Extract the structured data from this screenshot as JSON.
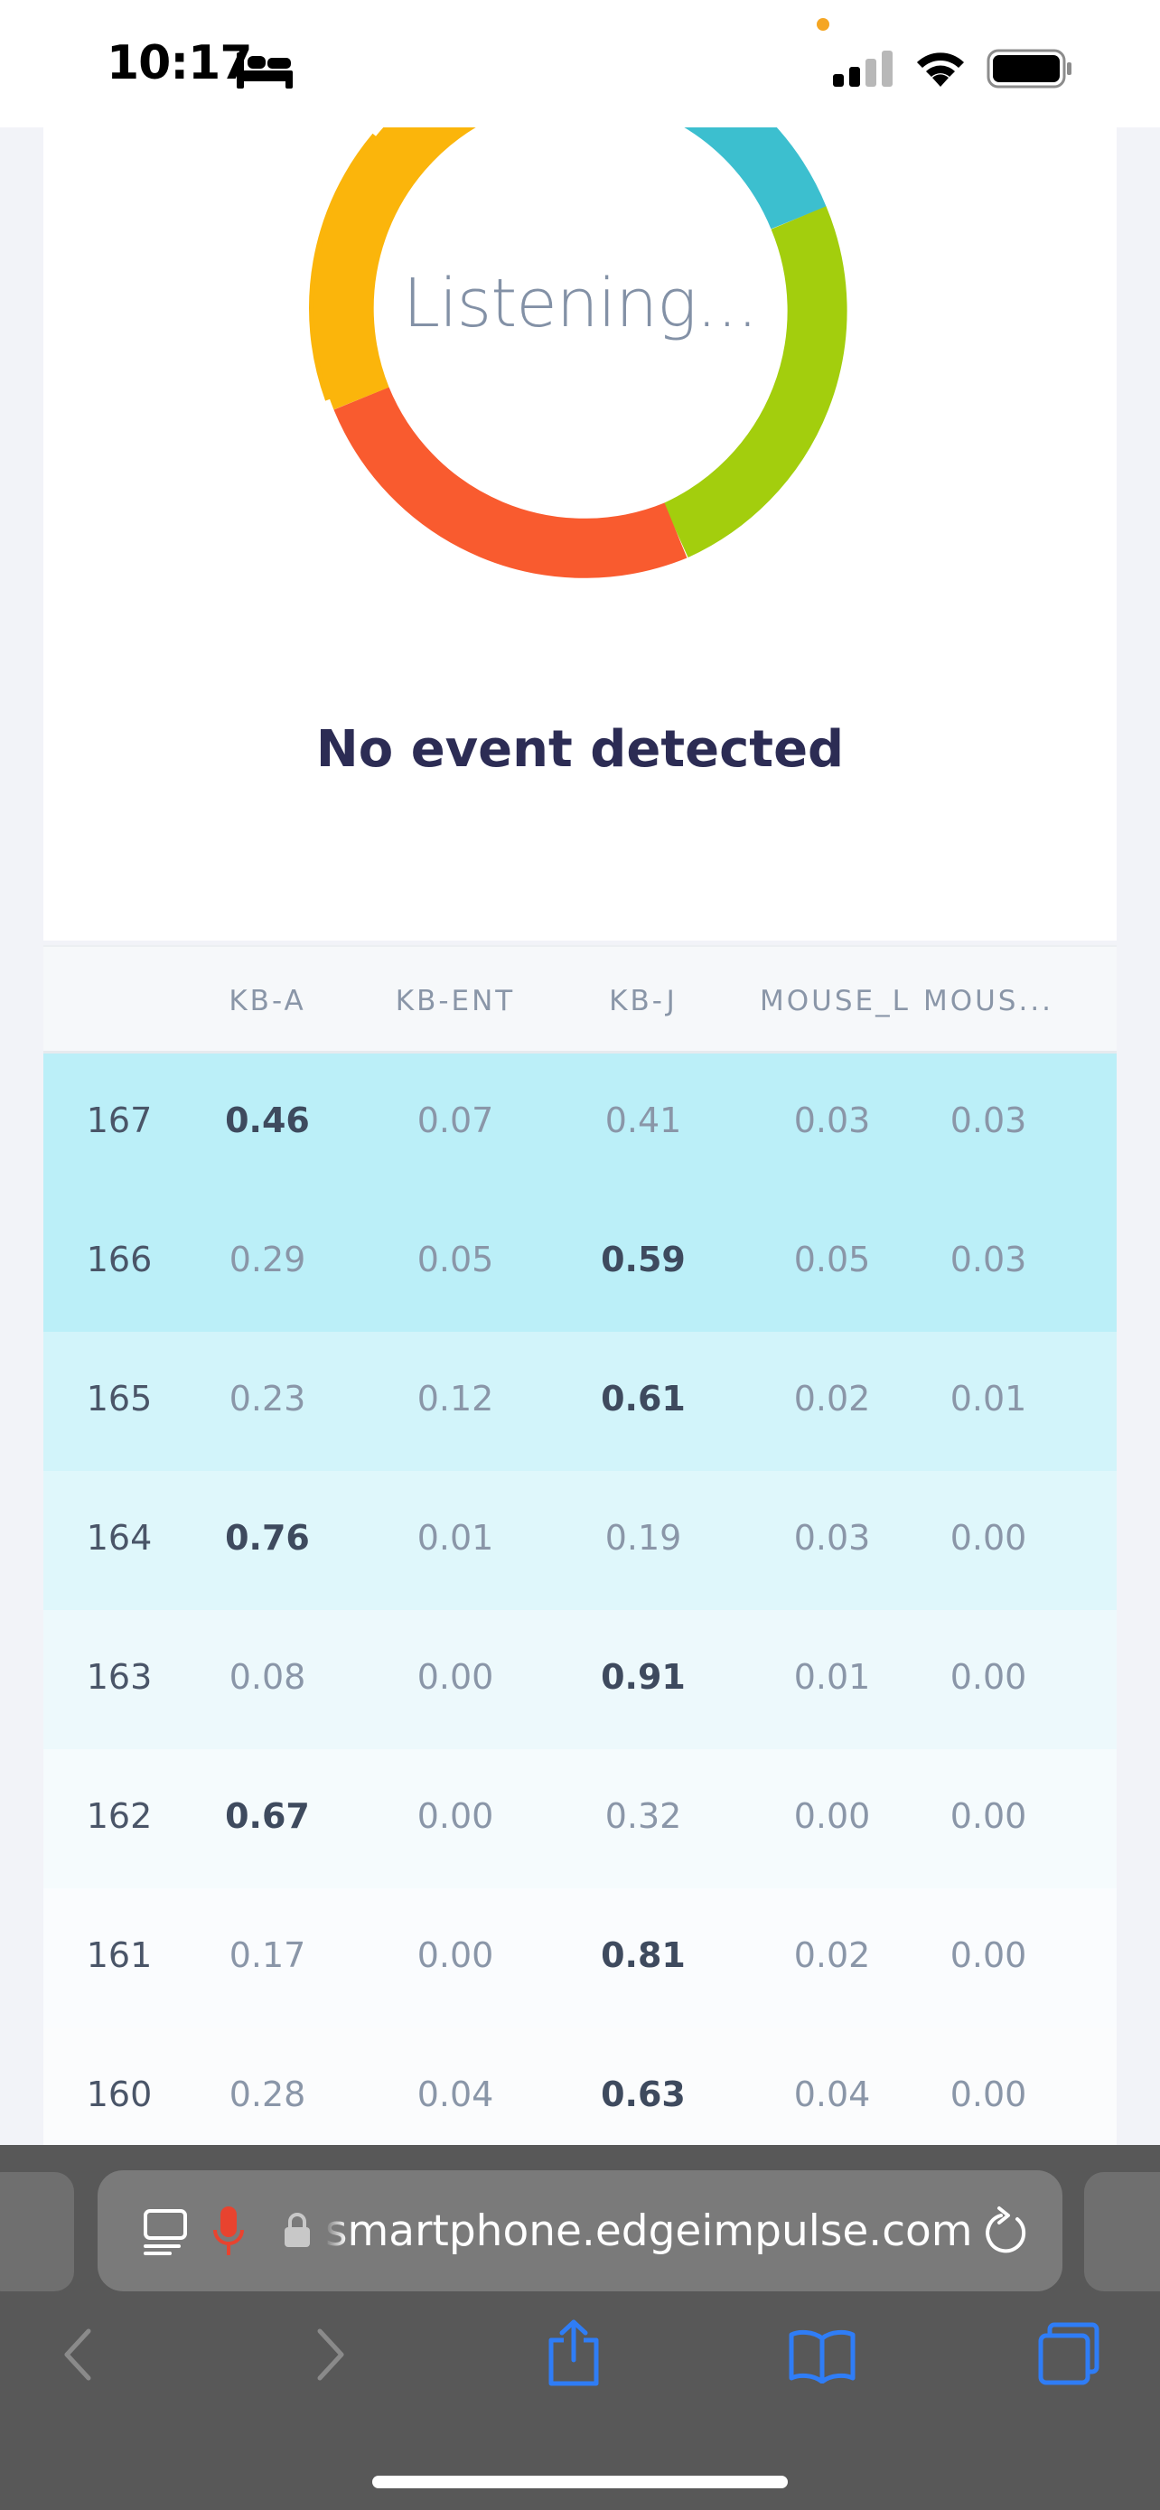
{
  "status_bar": {
    "time": "10:17"
  },
  "classifier": {
    "listening_label": "Listening...",
    "event_label": "No event detected",
    "ring_colors": [
      "#fbb50b",
      "#3cbfcf",
      "#a3ce0d",
      "#f95b2f"
    ]
  },
  "table": {
    "headers": [
      "",
      "KB-A",
      "KB-ENT",
      "KB-J",
      "MOUSE_L",
      "MOUS..."
    ],
    "rows": [
      {
        "idx": "167",
        "v": [
          "0.46",
          "0.07",
          "0.41",
          "0.03",
          "0.03"
        ],
        "max": 0,
        "bg": "#bbeff8"
      },
      {
        "idx": "166",
        "v": [
          "0.29",
          "0.05",
          "0.59",
          "0.05",
          "0.03"
        ],
        "max": 2,
        "bg": "#bbeff8"
      },
      {
        "idx": "165",
        "v": [
          "0.23",
          "0.12",
          "0.61",
          "0.02",
          "0.01"
        ],
        "max": 2,
        "bg": "#d2f4fa"
      },
      {
        "idx": "164",
        "v": [
          "0.76",
          "0.01",
          "0.19",
          "0.03",
          "0.00"
        ],
        "max": 0,
        "bg": "#dff7fb"
      },
      {
        "idx": "163",
        "v": [
          "0.08",
          "0.00",
          "0.91",
          "0.01",
          "0.00"
        ],
        "max": 2,
        "bg": "#edf9fc"
      },
      {
        "idx": "162",
        "v": [
          "0.67",
          "0.00",
          "0.32",
          "0.00",
          "0.00"
        ],
        "max": 0,
        "bg": "#f5fbfd"
      },
      {
        "idx": "161",
        "v": [
          "0.17",
          "0.00",
          "0.81",
          "0.02",
          "0.00"
        ],
        "max": 2,
        "bg": "#fafcfe"
      },
      {
        "idx": "160",
        "v": [
          "0.28",
          "0.04",
          "0.63",
          "0.04",
          "0.00"
        ],
        "max": 2,
        "bg": "#fbfcfd"
      }
    ]
  },
  "browser": {
    "url": "smartphone.edgeimpulse.com"
  }
}
